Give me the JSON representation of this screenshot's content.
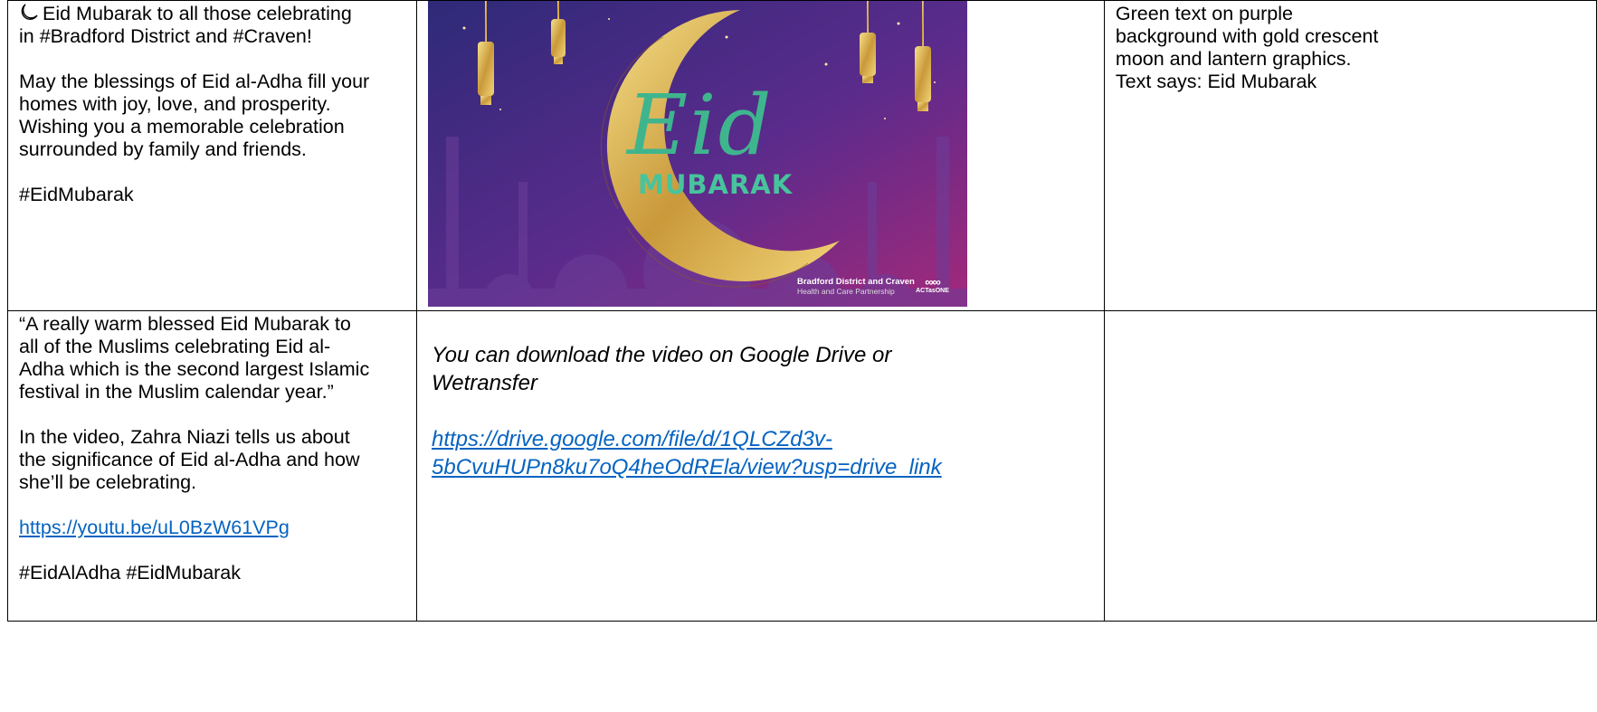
{
  "row1": {
    "col1": {
      "line1": "Eid Mubarak to all those celebrating",
      "line2": "in #Bradford District and #Craven!",
      "para2": [
        "May the blessings of Eid al-Adha fill your",
        "homes with joy, love, and prosperity.",
        "Wishing you a memorable celebration",
        "surrounded by family and friends."
      ],
      "hashtag": "#EidMubarak"
    },
    "image": {
      "title": "Eid",
      "subtitle": "MUBARAK",
      "brand_line1": "Bradford District and Craven",
      "brand_line2": "Health and Care Partnership",
      "logo_text": "ACTasONE"
    },
    "col3": [
      "Green text on purple",
      "background with gold crescent",
      "moon and lantern graphics.",
      "Text says: Eid Mubarak"
    ]
  },
  "row2": {
    "col1": {
      "quote": [
        "“A really warm blessed Eid Mubarak to",
        "all of the Muslims celebrating Eid al-",
        "Adha which is the second largest Islamic",
        "festival in the Muslim calendar year.”"
      ],
      "para": [
        "In the video, Zahra Niazi tells us about",
        "the significance of Eid al-Adha and how",
        "she’ll be celebrating."
      ],
      "link": "https://youtu.be/uL0BzW61VPg",
      "hashtags": "#EidAlAdha #EidMubarak"
    },
    "col2": {
      "note": [
        "You can download the video on Google Drive or",
        "Wetransfer"
      ],
      "link": [
        "https://drive.google.com/file/d/1QLCZd3v-",
        "5bCvuHUPn8ku7oQ4heOdREla/view?usp=drive_link"
      ]
    },
    "col3": ""
  },
  "icons": {
    "moon": "crescent-moon-icon"
  }
}
